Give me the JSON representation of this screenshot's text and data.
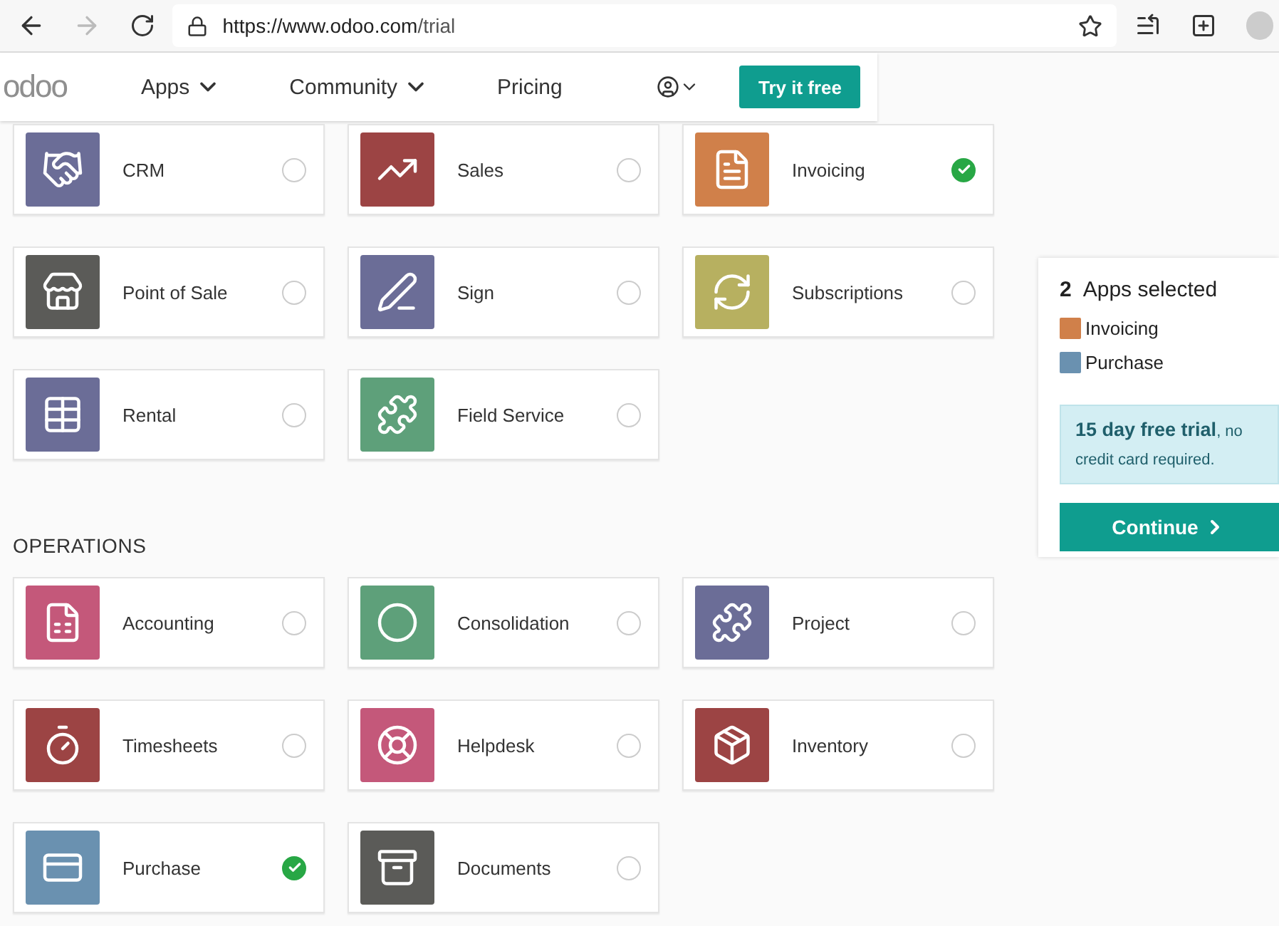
{
  "browser": {
    "url_host": "https://www.odoo.com",
    "url_path": "/trial"
  },
  "nav": {
    "logo": "odoo",
    "menus": [
      {
        "label": "Apps",
        "kind": "dropdown"
      },
      {
        "label": "Community",
        "kind": "dropdown"
      },
      {
        "label": "Pricing",
        "kind": "link"
      }
    ],
    "cta": "Try it free"
  },
  "sections": [
    {
      "apps": [
        {
          "name": "CRM",
          "color": "#6b6d97",
          "selected": false
        },
        {
          "name": "Sales",
          "color": "#9c4444",
          "selected": false
        },
        {
          "name": "Invoicing",
          "color": "#d0804a",
          "selected": true
        },
        {
          "name": "Point of Sale",
          "color": "#5b5b58",
          "selected": false
        },
        {
          "name": "Sign",
          "color": "#6b6d97",
          "selected": false
        },
        {
          "name": "Subscriptions",
          "color": "#b7b060",
          "selected": false
        },
        {
          "name": "Rental",
          "color": "#6b6d97",
          "selected": false
        },
        {
          "name": "Field Service",
          "color": "#5ea07a",
          "selected": false
        }
      ]
    },
    {
      "title": "OPERATIONS",
      "apps": [
        {
          "name": "Accounting",
          "color": "#c4587a",
          "selected": false
        },
        {
          "name": "Consolidation",
          "color": "#5ea07a",
          "selected": false
        },
        {
          "name": "Project",
          "color": "#6b6d97",
          "selected": false
        },
        {
          "name": "Timesheets",
          "color": "#9c4444",
          "selected": false
        },
        {
          "name": "Helpdesk",
          "color": "#c4587a",
          "selected": false
        },
        {
          "name": "Inventory",
          "color": "#9c4444",
          "selected": false
        },
        {
          "name": "Purchase",
          "color": "#6a91b0",
          "selected": true
        },
        {
          "name": "Documents",
          "color": "#5b5b58",
          "selected": false
        }
      ]
    }
  ],
  "summary": {
    "count": "2",
    "label": "Apps selected",
    "items": [
      {
        "name": "Invoicing",
        "color": "#d0804a"
      },
      {
        "name": "Purchase",
        "color": "#6a91b0"
      }
    ],
    "trial": "**15 day free trial**, no credit card required.",
    "button": "Continue"
  }
}
